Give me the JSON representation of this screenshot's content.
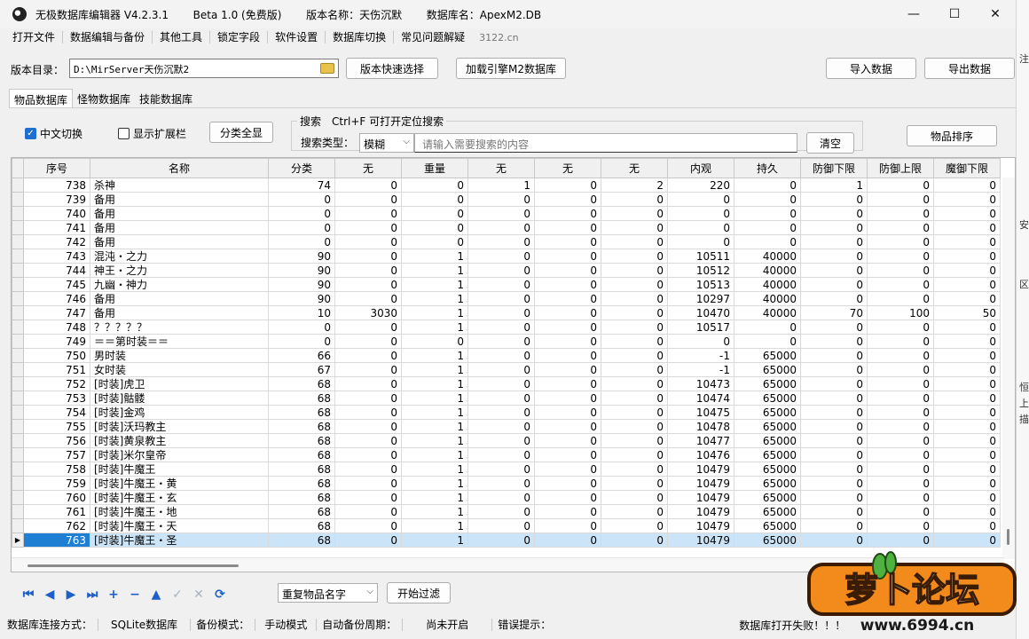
{
  "titlebar": {
    "app_name": "无极数据库编辑器 V4.2.3.1",
    "edition": "Beta 1.0 (免费版)",
    "version_name": "版本名称：天伤沉默",
    "db_name": "数据库名：ApexM2.DB",
    "minimize": "—",
    "maximize": "☐",
    "close": "✕"
  },
  "menu": [
    "打开文件",
    "数据编辑与备份",
    "其他工具",
    "锁定字段",
    "软件设置",
    "数据库切换",
    "常见问题解疑"
  ],
  "menu_site": "3122.cn",
  "side_strip": [
    "注",
    "安",
    "区",
    "恒",
    "上",
    "描"
  ],
  "version_row": {
    "label": "版本目录：",
    "path": "D:\\MirServer天伤沉默2",
    "quick_select": "版本快速选择",
    "load_engine": "加载引擎M2数据库",
    "import": "导入数据",
    "export": "导出数据"
  },
  "tabs": [
    "物品数据库",
    "怪物数据库",
    "技能数据库"
  ],
  "options": {
    "chinese_switch": "中文切换",
    "show_ext": "显示扩展栏",
    "show_all": "分类全显",
    "search_group_title": "搜索　Ctrl+F 可打开定位搜索",
    "search_type_label": "搜索类型：",
    "search_type_value": "模糊",
    "search_placeholder": "请输入需要搜索的内容",
    "clear": "清空",
    "sort": "物品排序"
  },
  "grid": {
    "columns": [
      "序号",
      "名称",
      "分类",
      "无",
      "重量",
      "无",
      "无",
      "无",
      "内观",
      "持久",
      "防御下限",
      "防御上限",
      "魔御下限"
    ],
    "rows": [
      [
        "738",
        "杀神",
        "74",
        "0",
        "0",
        "1",
        "0",
        "2",
        "220",
        "0",
        "1",
        "0",
        "0"
      ],
      [
        "739",
        "备用",
        "0",
        "0",
        "0",
        "0",
        "0",
        "0",
        "0",
        "0",
        "0",
        "0",
        "0"
      ],
      [
        "740",
        "备用",
        "0",
        "0",
        "0",
        "0",
        "0",
        "0",
        "0",
        "0",
        "0",
        "0",
        "0"
      ],
      [
        "741",
        "备用",
        "0",
        "0",
        "0",
        "0",
        "0",
        "0",
        "0",
        "0",
        "0",
        "0",
        "0"
      ],
      [
        "742",
        "备用",
        "0",
        "0",
        "0",
        "0",
        "0",
        "0",
        "0",
        "0",
        "0",
        "0",
        "0"
      ],
      [
        "743",
        "混沌・之力",
        "90",
        "0",
        "1",
        "0",
        "0",
        "0",
        "10511",
        "40000",
        "0",
        "0",
        "0"
      ],
      [
        "744",
        "神王・之力",
        "90",
        "0",
        "1",
        "0",
        "0",
        "0",
        "10512",
        "40000",
        "0",
        "0",
        "0"
      ],
      [
        "745",
        "九幽・神力",
        "90",
        "0",
        "1",
        "0",
        "0",
        "0",
        "10513",
        "40000",
        "0",
        "0",
        "0"
      ],
      [
        "746",
        "备用",
        "90",
        "0",
        "1",
        "0",
        "0",
        "0",
        "10297",
        "40000",
        "0",
        "0",
        "0"
      ],
      [
        "747",
        "备用",
        "10",
        "3030",
        "1",
        "0",
        "0",
        "0",
        "10470",
        "40000",
        "70",
        "100",
        "50"
      ],
      [
        "748",
        "？？？？？",
        "0",
        "0",
        "1",
        "0",
        "0",
        "0",
        "10517",
        "0",
        "0",
        "0",
        "0"
      ],
      [
        "749",
        "＝＝第时装＝＝",
        "0",
        "0",
        "0",
        "0",
        "0",
        "0",
        "0",
        "0",
        "0",
        "0",
        "0"
      ],
      [
        "750",
        "男时装",
        "66",
        "0",
        "1",
        "0",
        "0",
        "0",
        "-1",
        "65000",
        "0",
        "0",
        "0"
      ],
      [
        "751",
        "女时装",
        "67",
        "0",
        "1",
        "0",
        "0",
        "0",
        "-1",
        "65000",
        "0",
        "0",
        "0"
      ],
      [
        "752",
        "[时装]虎卫",
        "68",
        "0",
        "1",
        "0",
        "0",
        "0",
        "10473",
        "65000",
        "0",
        "0",
        "0"
      ],
      [
        "753",
        "[时装]骷髅",
        "68",
        "0",
        "1",
        "0",
        "0",
        "0",
        "10474",
        "65000",
        "0",
        "0",
        "0"
      ],
      [
        "754",
        "[时装]金鸡",
        "68",
        "0",
        "1",
        "0",
        "0",
        "0",
        "10475",
        "65000",
        "0",
        "0",
        "0"
      ],
      [
        "755",
        "[时装]沃玛教主",
        "68",
        "0",
        "1",
        "0",
        "0",
        "0",
        "10478",
        "65000",
        "0",
        "0",
        "0"
      ],
      [
        "756",
        "[时装]黄泉教主",
        "68",
        "0",
        "1",
        "0",
        "0",
        "0",
        "10477",
        "65000",
        "0",
        "0",
        "0"
      ],
      [
        "757",
        "[时装]米尔皇帝",
        "68",
        "0",
        "1",
        "0",
        "0",
        "0",
        "10476",
        "65000",
        "0",
        "0",
        "0"
      ],
      [
        "758",
        "[时装]牛魔王",
        "68",
        "0",
        "1",
        "0",
        "0",
        "0",
        "10479",
        "65000",
        "0",
        "0",
        "0"
      ],
      [
        "759",
        "[时装]牛魔王・黄",
        "68",
        "0",
        "1",
        "0",
        "0",
        "0",
        "10479",
        "65000",
        "0",
        "0",
        "0"
      ],
      [
        "760",
        "[时装]牛魔王・玄",
        "68",
        "0",
        "1",
        "0",
        "0",
        "0",
        "10479",
        "65000",
        "0",
        "0",
        "0"
      ],
      [
        "761",
        "[时装]牛魔王・地",
        "68",
        "0",
        "1",
        "0",
        "0",
        "0",
        "10479",
        "65000",
        "0",
        "0",
        "0"
      ],
      [
        "762",
        "[时装]牛魔王・天",
        "68",
        "0",
        "1",
        "0",
        "0",
        "0",
        "10479",
        "65000",
        "0",
        "0",
        "0"
      ],
      [
        "763",
        "[时装]牛魔王・圣",
        "68",
        "0",
        "1",
        "0",
        "0",
        "0",
        "10479",
        "65000",
        "0",
        "0",
        "0"
      ]
    ],
    "selected_row": 25,
    "row_indicator": "▶"
  },
  "nav": [
    {
      "icon": "first-record-icon",
      "glyph": "⏮"
    },
    {
      "icon": "prev-record-icon",
      "glyph": "◀"
    },
    {
      "icon": "next-record-icon",
      "glyph": "▶"
    },
    {
      "icon": "last-record-icon",
      "glyph": "⏭"
    },
    {
      "icon": "add-record-icon",
      "glyph": "+"
    },
    {
      "icon": "delete-record-icon",
      "glyph": "−"
    },
    {
      "icon": "edit-record-icon",
      "glyph": "▲"
    },
    {
      "icon": "post-record-icon",
      "glyph": "✓"
    },
    {
      "icon": "cancel-record-icon",
      "glyph": "✕"
    },
    {
      "icon": "refresh-icon",
      "glyph": "⟳"
    }
  ],
  "filter": {
    "value": "重复物品名字",
    "start": "开始过滤"
  },
  "status": {
    "conn_label": "数据库连接方式：",
    "conn_value": "SQLite数据库",
    "backup_label": "备份模式：",
    "backup_value": "手动模式",
    "auto_label": "自动备份周期：",
    "auto_value": "尚未开启",
    "error_label": "错误提示：",
    "error_value": "数据库打开失败！！！"
  },
  "logo": {
    "name": "萝卜论坛",
    "url": "www.6994.cn"
  },
  "colors": {
    "selection": "#cce4f7",
    "selected_index": "#1e7fd3",
    "nav_blue": "#1f5fc9",
    "logo_orange": "#f28a1c"
  }
}
